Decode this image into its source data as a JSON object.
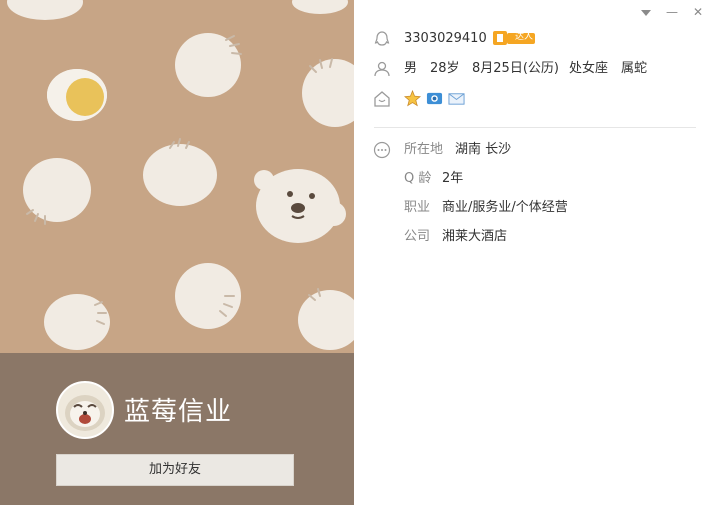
{
  "profile": {
    "nickname": "蓝莓信业",
    "add_friend_label": "加为好友"
  },
  "window": {
    "dropdown_icon": "chevron-down-icon",
    "minimize_icon": "minimize-icon",
    "close_icon": "close-icon",
    "minimize_glyph": "—",
    "close_glyph": "✕"
  },
  "info": {
    "qq_number": "3303029410",
    "gender": "男",
    "age": "28岁",
    "birthday": "8月25日(公历)",
    "zodiac": "处女座",
    "chinese_zodiac": "属蛇",
    "badge_text": "达人"
  },
  "details": [
    {
      "label": "所在地",
      "value": "湖南 长沙"
    },
    {
      "label": "Q 龄",
      "value": "2年"
    },
    {
      "label": "职业",
      "value": "商业/服务业/个体经营"
    },
    {
      "label": "公司",
      "value": "湘莱大酒店"
    }
  ],
  "colors": {
    "banner_bg": "#c7a586",
    "bottom_bg": "#8b7767",
    "bun": "#f1ebe3",
    "badge_orange": "#f5a623"
  }
}
